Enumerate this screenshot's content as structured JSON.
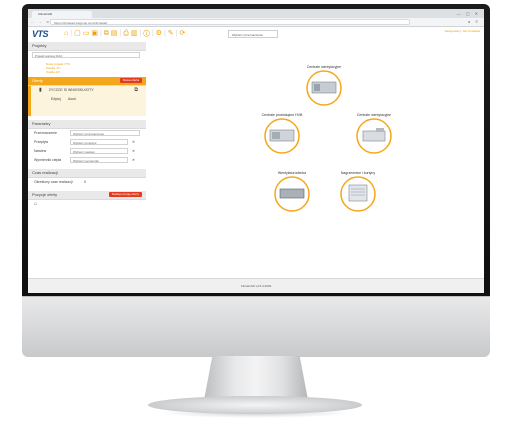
{
  "browser": {
    "tab_title": "ClimaCAD",
    "url": "https://climacad.vtsgroup.com/climacad/",
    "nav_icons": "← → C",
    "window_buttons": "— ▢ ✕"
  },
  "app": {
    "logo": "VTS",
    "project_select": "Wybierz przeznaczenie",
    "user_info": "Zalogowany: Jan Kowalski"
  },
  "sidebar": {
    "project": {
      "header": "Projekty",
      "select_value": "Projekt testowy DAC",
      "details": [
        "Nowy projekt VTS",
        "Polska, PL",
        "Osoba 1/3"
      ]
    },
    "offers": {
      "header": "Oferty",
      "badge": "Nowa oferta",
      "item_name": "ZYCZCE SI WNIOSKUJOTY",
      "actions": [
        "Edytuj",
        "Usuń"
      ]
    },
    "params": {
      "header": "Parametry",
      "rows": [
        {
          "label": "Przeznaczenie",
          "value": "Wybierz przeznaczenie"
        },
        {
          "label": "Przepływ",
          "value": "Wybierz przepływ"
        },
        {
          "label": "Nawiew",
          "value": "Wybierz nawiew"
        },
        {
          "label": "Wymiennik ciepła",
          "value": "Wybierz wymiennik"
        }
      ]
    },
    "time": {
      "header": "Czas realizacji",
      "label": "Określony czas realizacji",
      "value": "0"
    },
    "items": {
      "header": "Pozycje oferty",
      "badge": "Dodaj pozycję oferty"
    }
  },
  "diagram": {
    "nodes": [
      {
        "label": "Centrale wentylacyjne"
      },
      {
        "label": "Centrale prostokątne HVB"
      },
      {
        "label": "Centrale wentylacyjne"
      },
      {
        "label": "Wentylatorodenka"
      },
      {
        "label": "Nagrzewnice i kurtyny"
      }
    ]
  },
  "status": {
    "version": "ClimaCAD v4.5.4.0203"
  },
  "colors": {
    "accent": "#f5a71c",
    "brand": "#1b4d8c",
    "danger": "#e23b1e"
  }
}
